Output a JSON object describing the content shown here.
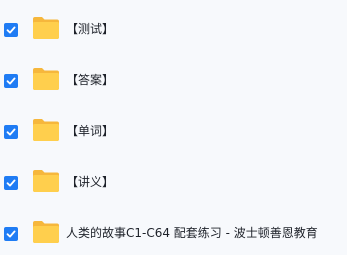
{
  "files": [
    {
      "name": "【测试】",
      "checked": true,
      "icon": "folder-icon"
    },
    {
      "name": "【答案】",
      "checked": true,
      "icon": "folder-icon"
    },
    {
      "name": "【单词】",
      "checked": true,
      "icon": "folder-icon"
    },
    {
      "name": "【讲义】",
      "checked": true,
      "icon": "folder-icon"
    },
    {
      "name": "人类的故事C1-C64 配套练习 - 波士顿善恩教育",
      "checked": true,
      "icon": "folder-icon"
    }
  ],
  "colors": {
    "checkbox": "#1f7cf4",
    "folder_back": "#f6b73c",
    "folder_front": "#ffcf4d",
    "background": "#f7f9fc",
    "text": "#1d2129"
  }
}
